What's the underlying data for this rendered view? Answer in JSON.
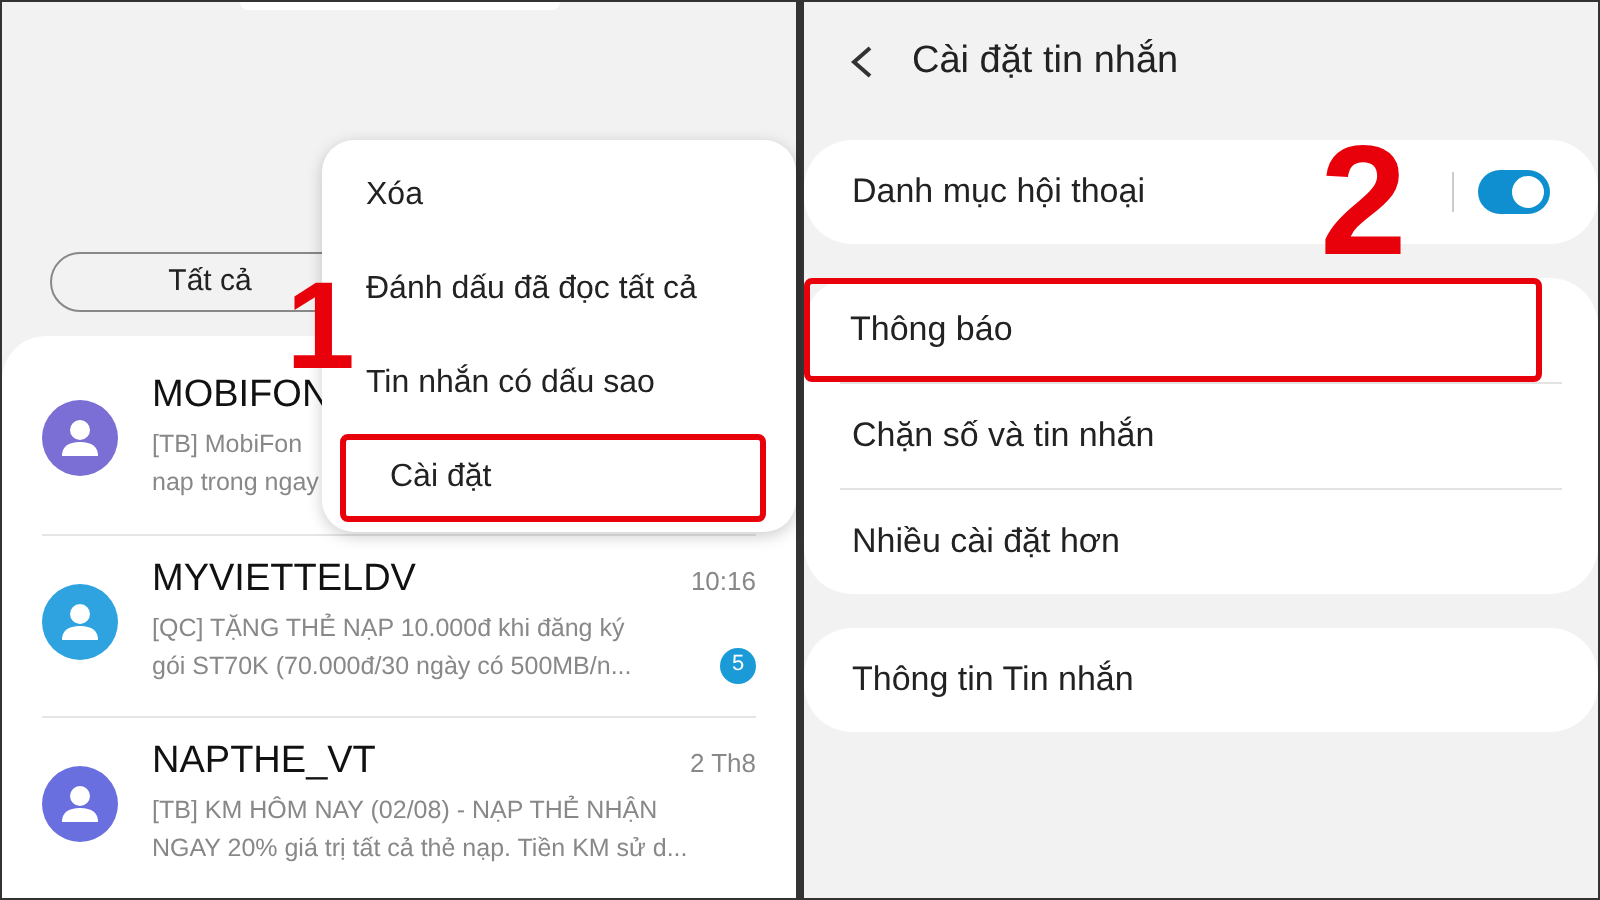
{
  "left_screen": {
    "filter": {
      "label": "Tất cả"
    },
    "conversations": [
      {
        "name": "MOBIFON",
        "preview_lines": [
          "[TB] MobiFon",
          "nap trong ngay"
        ],
        "color": "#7b6fd6"
      },
      {
        "name": "MYVIETTELDV",
        "time": "10:16",
        "preview_lines": [
          "[QC] TẶNG THẺ NẠP 10.000đ khi đăng ký",
          "gói ST70K (70.000đ/30 ngày có 500MB/n..."
        ],
        "color": "#2ea3e0",
        "unread": "5"
      },
      {
        "name": "NAPTHE_VT",
        "time": "2 Th8",
        "preview_lines": [
          "[TB] KM HÔM NAY (02/08) - NẠP THẺ NHẬN",
          "NGAY 20% giá trị tất cả thẻ nạp. Tiền KM sử d..."
        ],
        "color": "#6a6fe0"
      }
    ],
    "menu": [
      {
        "label": "Xóa",
        "highlighted": false
      },
      {
        "label": "Đánh dấu đã đọc tất cả",
        "highlighted": false
      },
      {
        "label": "Tin nhắn có dấu sao",
        "highlighted": false
      },
      {
        "label": "Cài đặt",
        "highlighted": true
      }
    ],
    "step": "1"
  },
  "right_screen": {
    "title": "Cài đặt tin nhắn",
    "step": "2",
    "groups": [
      [
        {
          "label": "Danh mục hội thoại",
          "kind": "toggle",
          "on": true,
          "highlighted": false
        }
      ],
      [
        {
          "label": "Thông báo",
          "kind": "link",
          "highlighted": true
        },
        {
          "label": "Chặn số và tin nhắn",
          "kind": "link",
          "highlighted": false
        },
        {
          "label": "Nhiều cài đặt hơn",
          "kind": "link",
          "highlighted": false
        }
      ],
      [
        {
          "label": "Thông tin Tin nhắn",
          "kind": "link",
          "highlighted": false
        }
      ]
    ]
  }
}
